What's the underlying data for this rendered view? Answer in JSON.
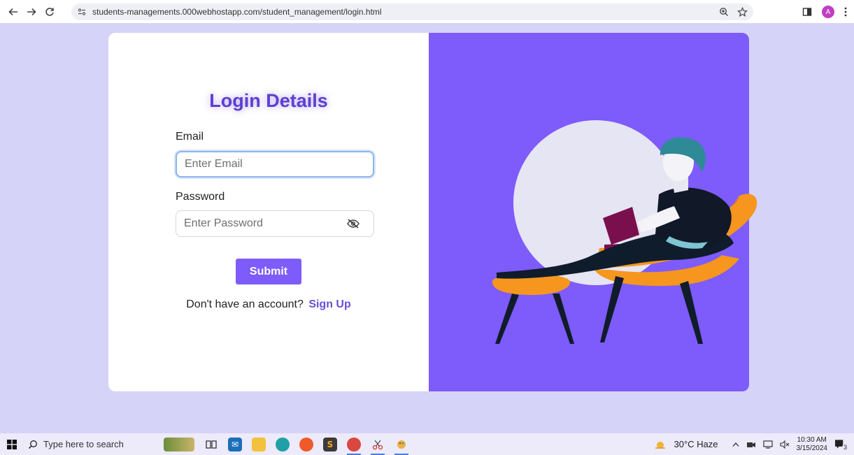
{
  "browser": {
    "url": "students-managements.000webhostapp.com/student_management/login.html",
    "profile_initial": "A"
  },
  "login": {
    "title": "Login Details",
    "email_label": "Email",
    "email_placeholder": "Enter Email",
    "password_label": "Password",
    "password_placeholder": "Enter Password",
    "submit_label": "Submit",
    "no_account_text": "Don't have an account?",
    "signup_link": "Sign Up"
  },
  "colors": {
    "accent": "#7e5bfb",
    "page_background": "#d5d3f7",
    "title": "#5d3fd3"
  },
  "taskbar": {
    "search_placeholder": "Type here to search",
    "weather": "30°C  Haze",
    "time": "10:30 AM",
    "date": "3/15/2024",
    "notification_count": "3",
    "pinned_icons": [
      "task-view-icon",
      "mail-icon",
      "file-explorer-icon",
      "edge-icon",
      "brave-icon",
      "sublime-text-icon",
      "chrome-icon",
      "snipping-tool-icon",
      "paint-icon"
    ]
  }
}
